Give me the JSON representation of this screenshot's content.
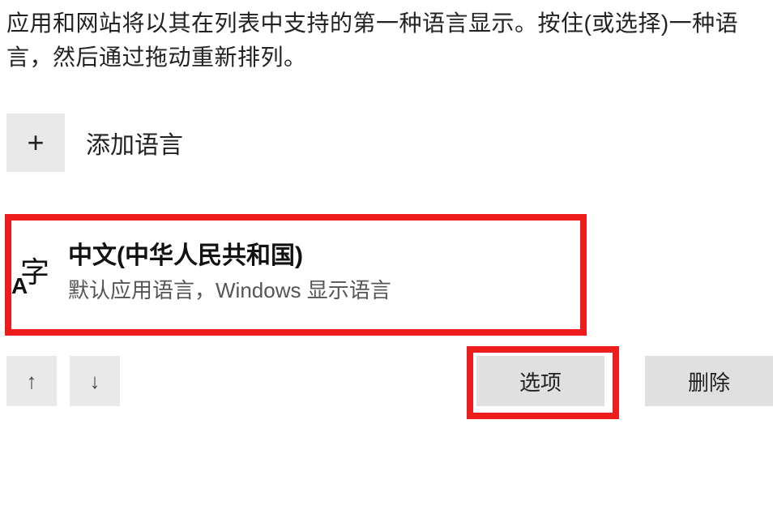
{
  "description": "应用和网站将以其在列表中支持的第一种语言显示。按住(或选择)一种语言，然后通过拖动重新排列。",
  "addLanguage": {
    "label": "添加语言"
  },
  "language": {
    "iconGlyph": "字",
    "iconSub": "A",
    "name": "中文(中华人民共和国)",
    "subtitle": "默认应用语言，Windows 显示语言"
  },
  "buttons": {
    "options": "选项",
    "delete": "删除"
  }
}
